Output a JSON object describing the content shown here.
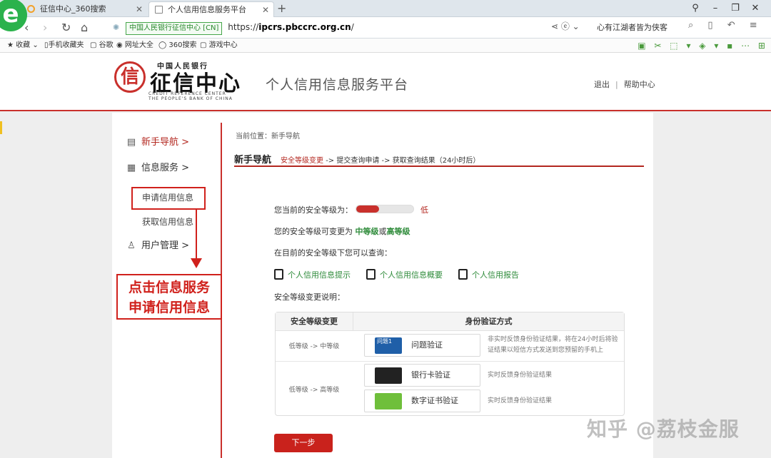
{
  "browser": {
    "tabs": [
      {
        "label": "征信中心_360搜索"
      },
      {
        "label": "个人信用信息服务平台"
      }
    ],
    "new_tab": "+",
    "secure_label": "中国人民银行征信中心 [CN]",
    "url_prefix": "https://",
    "url_domain": "ipcrs.pbccrc.org.cn",
    "url_suffix": "/",
    "search_text": "心有江湖者皆为侠客",
    "bookmarks": [
      "收藏",
      "手机收藏夹",
      "谷歌",
      "网址大全",
      "360搜索",
      "游戏中心"
    ]
  },
  "header": {
    "logo_small": "中国人民银行",
    "logo_big": "征信中心",
    "logo_en_line1": "CREDIT REFERENCE CENTER",
    "logo_en_line2": "THE PEOPLE'S BANK OF CHINA",
    "platform_title": "个人信用信息服务平台",
    "logout": "退出",
    "separator": "|",
    "help": "帮助中心"
  },
  "sidebar": {
    "items": [
      {
        "label": "新手导航",
        "arrow": ">"
      },
      {
        "label": "信息服务",
        "arrow": ">"
      },
      {
        "label": "用户管理",
        "arrow": ">"
      }
    ],
    "sub_items": [
      {
        "label": "申请信用信息"
      },
      {
        "label": "获取信用信息"
      }
    ]
  },
  "annotation": {
    "line1": "点击信息服务",
    "line2": "申请信用信息"
  },
  "main": {
    "breadcrumb": "当前位置：新手导航",
    "section_title": "新手导航",
    "steps": {
      "step1": "安全等级变更",
      "step2": "-> 提交查询申请",
      "step3": "-> 获取查询结果（24小时后）"
    },
    "current_level_label": "您当前的安全等级为：",
    "current_level_value": "低",
    "current_level_fraction": 0.4,
    "change_prefix": "您的安全等级可变更为",
    "change_mid": "中等级",
    "change_or": "或",
    "change_high": "高等级",
    "query_intro": "在目前的安全等级下您可以查询：",
    "query_links": [
      {
        "label": "个人信用信息提示"
      },
      {
        "label": "个人信用信息概要"
      },
      {
        "label": "个人信用报告"
      }
    ],
    "change_note": "安全等级变更说明：",
    "table": {
      "col1": "安全等级变更",
      "col2": "身份验证方式",
      "row1_level": "低等级 -> 中等级",
      "row2_level": "低等级 -> 高等级",
      "methods": [
        {
          "label": "问题验证",
          "img_text": "问题1",
          "desc": "非实时反馈身份验证结果，将在24小时后将验证结果以短信方式发送到您预留的手机上"
        },
        {
          "label": "银行卡验证",
          "desc": "实时反馈身份验证结果"
        },
        {
          "label": "数字证书验证",
          "desc": "实时反馈身份验证结果"
        }
      ]
    },
    "next_button": "下一步"
  },
  "watermark": "知乎 @荔枝金服",
  "colors": {
    "brand_red": "#c9302c",
    "link_green": "#2e8b3a"
  }
}
